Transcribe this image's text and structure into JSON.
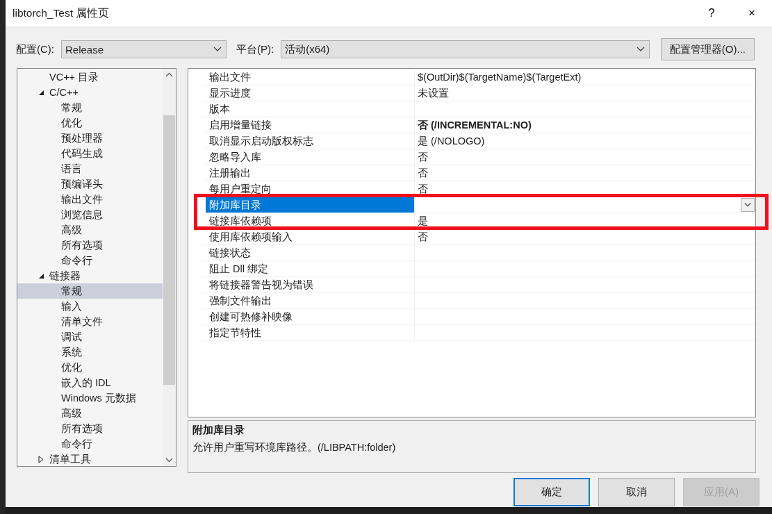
{
  "window": {
    "title": "libtorch_Test 属性页",
    "help_button": "?",
    "close_button": "×"
  },
  "toolbar": {
    "config_label": "配置(C):",
    "config_value": "Release",
    "platform_label": "平台(P):",
    "platform_value": "活动(x64)",
    "manager_button": "配置管理器(O)..."
  },
  "tree": [
    {
      "label": "VC++ 目录",
      "selected": false
    },
    {
      "label": "C/C++",
      "selected": false,
      "expanded": true,
      "children": [
        {
          "label": "常规",
          "selected": false
        },
        {
          "label": "优化",
          "selected": false
        },
        {
          "label": "预处理器",
          "selected": false
        },
        {
          "label": "代码生成",
          "selected": false
        },
        {
          "label": "语言",
          "selected": false
        },
        {
          "label": "预编译头",
          "selected": false
        },
        {
          "label": "输出文件",
          "selected": false
        },
        {
          "label": "浏览信息",
          "selected": false
        },
        {
          "label": "高级",
          "selected": false
        },
        {
          "label": "所有选项",
          "selected": false
        },
        {
          "label": "命令行",
          "selected": false
        }
      ]
    },
    {
      "label": "链接器",
      "selected": false,
      "expanded": true,
      "children": [
        {
          "label": "常规",
          "selected": true
        },
        {
          "label": "输入",
          "selected": false
        },
        {
          "label": "清单文件",
          "selected": false
        },
        {
          "label": "调试",
          "selected": false
        },
        {
          "label": "系统",
          "selected": false
        },
        {
          "label": "优化",
          "selected": false
        },
        {
          "label": "嵌入的 IDL",
          "selected": false
        },
        {
          "label": "Windows 元数据",
          "selected": false
        },
        {
          "label": "高级",
          "selected": false
        },
        {
          "label": "所有选项",
          "selected": false
        },
        {
          "label": "命令行",
          "selected": false
        }
      ]
    },
    {
      "label": "清单工具",
      "selected": false,
      "expanded": false
    }
  ],
  "grid": {
    "rows": [
      {
        "name": "输出文件",
        "value": "$(OutDir)$(TargetName)$(TargetExt)",
        "modified": false,
        "selected": false,
        "highlighted": false
      },
      {
        "name": "显示进度",
        "value": "未设置",
        "modified": false,
        "selected": false,
        "highlighted": false
      },
      {
        "name": "版本",
        "selected": false,
        "highlighted": false
      },
      {
        "name": "启用增量链接",
        "value": "否 (/INCREMENTAL:NO)",
        "modified": true,
        "selected": false,
        "highlighted": false
      },
      {
        "name": "取消显示启动版权标志",
        "value": "是 (/NOLOGO)",
        "modified": false,
        "selected": false,
        "highlighted": false
      },
      {
        "name": "忽略导入库",
        "value": "否",
        "modified": false,
        "selected": false,
        "highlighted": false
      },
      {
        "name": "注册输出",
        "value": "否",
        "modified": false,
        "selected": false,
        "highlighted": false
      },
      {
        "name": "每用户重定向",
        "value": "否",
        "modified": false,
        "selected": false,
        "highlighted": false
      },
      {
        "name": "附加库目录",
        "selected": true,
        "highlighted": true
      },
      {
        "name": "链接库依赖项",
        "value": "是",
        "modified": false,
        "selected": false,
        "highlighted": true
      },
      {
        "name": "使用库依赖项输入",
        "value": "否",
        "modified": false,
        "selected": false,
        "highlighted": false
      },
      {
        "name": "链接状态",
        "selected": false,
        "highlighted": false
      },
      {
        "name": "阻止 Dll 绑定",
        "selected": false,
        "highlighted": false
      },
      {
        "name": "将链接器警告视为错误",
        "selected": false,
        "highlighted": false
      },
      {
        "name": "强制文件输出",
        "selected": false,
        "highlighted": false
      },
      {
        "name": "创建可热修补映像",
        "selected": false,
        "highlighted": false
      },
      {
        "name": "指定节特性",
        "selected": false,
        "highlighted": false
      }
    ]
  },
  "description": {
    "title": "附加库目录",
    "text": "允许用户重写环境库路径。(/LIBPATH:folder)"
  },
  "buttons": [
    {
      "label": "确定",
      "default": true,
      "disabled": false
    },
    {
      "label": "取消",
      "default": false,
      "disabled": false
    },
    {
      "label": "应用(A)",
      "default": false,
      "disabled": true
    }
  ]
}
